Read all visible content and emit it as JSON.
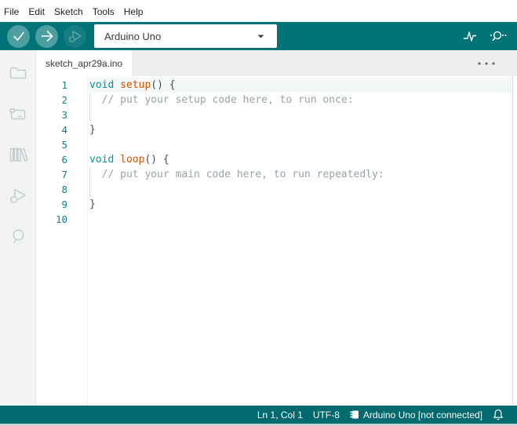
{
  "menu": {
    "items": [
      "File",
      "Edit",
      "Sketch",
      "Tools",
      "Help"
    ]
  },
  "toolbar": {
    "verify_label": "Verify",
    "upload_label": "Upload",
    "debug_label": "Start Debugging",
    "board_selector": {
      "value": "Arduino Uno"
    },
    "serial_plotter_label": "Serial Plotter",
    "serial_monitor_label": "Serial Monitor"
  },
  "tabs": {
    "active": "sketch_apr29a.ino"
  },
  "sidebar": {
    "items": [
      "Sketchbook",
      "Boards Manager",
      "Library Manager",
      "Debug",
      "Search"
    ]
  },
  "editor": {
    "lines": [
      {
        "n": "1",
        "active": true,
        "spans": [
          [
            "kw",
            "void"
          ],
          [
            "pl",
            " "
          ],
          [
            "fn",
            "setup"
          ],
          [
            "pl",
            "() {"
          ]
        ]
      },
      {
        "n": "2",
        "guide": true,
        "spans": [
          [
            "cm",
            "  // put your setup code here, to run once:"
          ]
        ]
      },
      {
        "n": "3",
        "guide": true,
        "spans": []
      },
      {
        "n": "4",
        "spans": [
          [
            "pl",
            "}"
          ]
        ]
      },
      {
        "n": "5",
        "spans": []
      },
      {
        "n": "6",
        "spans": [
          [
            "kw",
            "void"
          ],
          [
            "pl",
            " "
          ],
          [
            "fn",
            "loop"
          ],
          [
            "pl",
            "() {"
          ]
        ]
      },
      {
        "n": "7",
        "guide": true,
        "spans": [
          [
            "cm",
            "  // put your main code here, to run repeatedly:"
          ]
        ]
      },
      {
        "n": "8",
        "guide": true,
        "spans": []
      },
      {
        "n": "9",
        "spans": [
          [
            "pl",
            "}"
          ]
        ]
      },
      {
        "n": "10",
        "spans": []
      }
    ]
  },
  "status": {
    "position": "Ln 1, Col 1",
    "encoding": "UTF-8",
    "board": "Arduino Uno [not connected]"
  },
  "colors": {
    "toolbar_bg": "#007378",
    "button_bg": "#4D9EA1",
    "status_bg": "#006A6F",
    "keyword": "#00979D",
    "function": "#D35400",
    "comment": "#95A5A6"
  }
}
